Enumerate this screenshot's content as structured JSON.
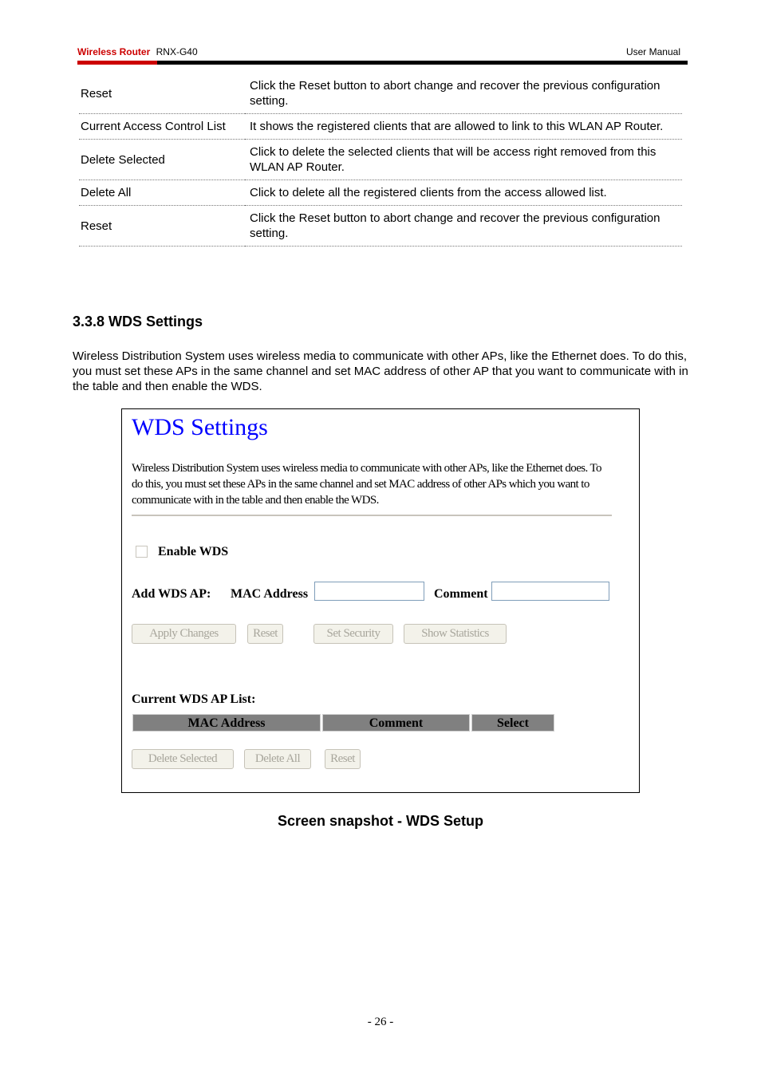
{
  "header": {
    "brand": "Wireless  Router",
    "model": "RNX-G40",
    "doc_type": "User  Manual",
    "accent_color": "#cc0000"
  },
  "desc_table": [
    {
      "term": "Reset",
      "definition": "Click the Reset button to abort change and recover the previous configuration setting."
    },
    {
      "term": "Current Access Control List",
      "definition": "It shows the registered clients that are allowed to link to    this WLAN AP Router."
    },
    {
      "term": "Delete Selected",
      "definition": "Click to delete the selected clients that will be access right removed from this WLAN AP Router."
    },
    {
      "term": "Delete All",
      "definition": "Click to delete all the registered clients from the access allowed list."
    },
    {
      "term": "Reset",
      "definition": "Click the Reset button to abort change and recover the previous configuration setting."
    }
  ],
  "section": {
    "title": "3.3.8 WDS Settings",
    "intro": "Wireless Distribution System uses wireless media to communicate with other APs, like the Ethernet does. To do this, you must set these APs in the same channel and set MAC address of other AP that you want to communicate with in the table and then enable the WDS."
  },
  "snapshot": {
    "title": "WDS Settings",
    "title_color": "#0000ff",
    "description": "Wireless Distribution System uses wireless media to communicate with other APs, like the Ethernet does. To do this, you must set these APs in the same channel and set MAC address of other APs which you want to communicate with in the table and then enable the WDS.",
    "enable_wds_label": "Enable WDS",
    "enable_wds_checked": false,
    "add_wds_ap_label": "Add WDS AP:",
    "mac_address_label": "MAC Address",
    "mac_address_value": "",
    "comment_label": "Comment",
    "comment_value": "",
    "buttons": {
      "apply_changes": "Apply Changes",
      "reset": "Reset",
      "set_security": "Set Security",
      "show_statistics": "Show Statistics",
      "delete_selected": "Delete Selected",
      "delete_all": "Delete All",
      "reset_list": "Reset"
    },
    "list_label": "Current WDS AP List:",
    "list_columns": [
      "MAC Address",
      "Comment",
      "Select"
    ]
  },
  "caption": "Screen snapshot - WDS Setup",
  "page_number": "- 26 -"
}
